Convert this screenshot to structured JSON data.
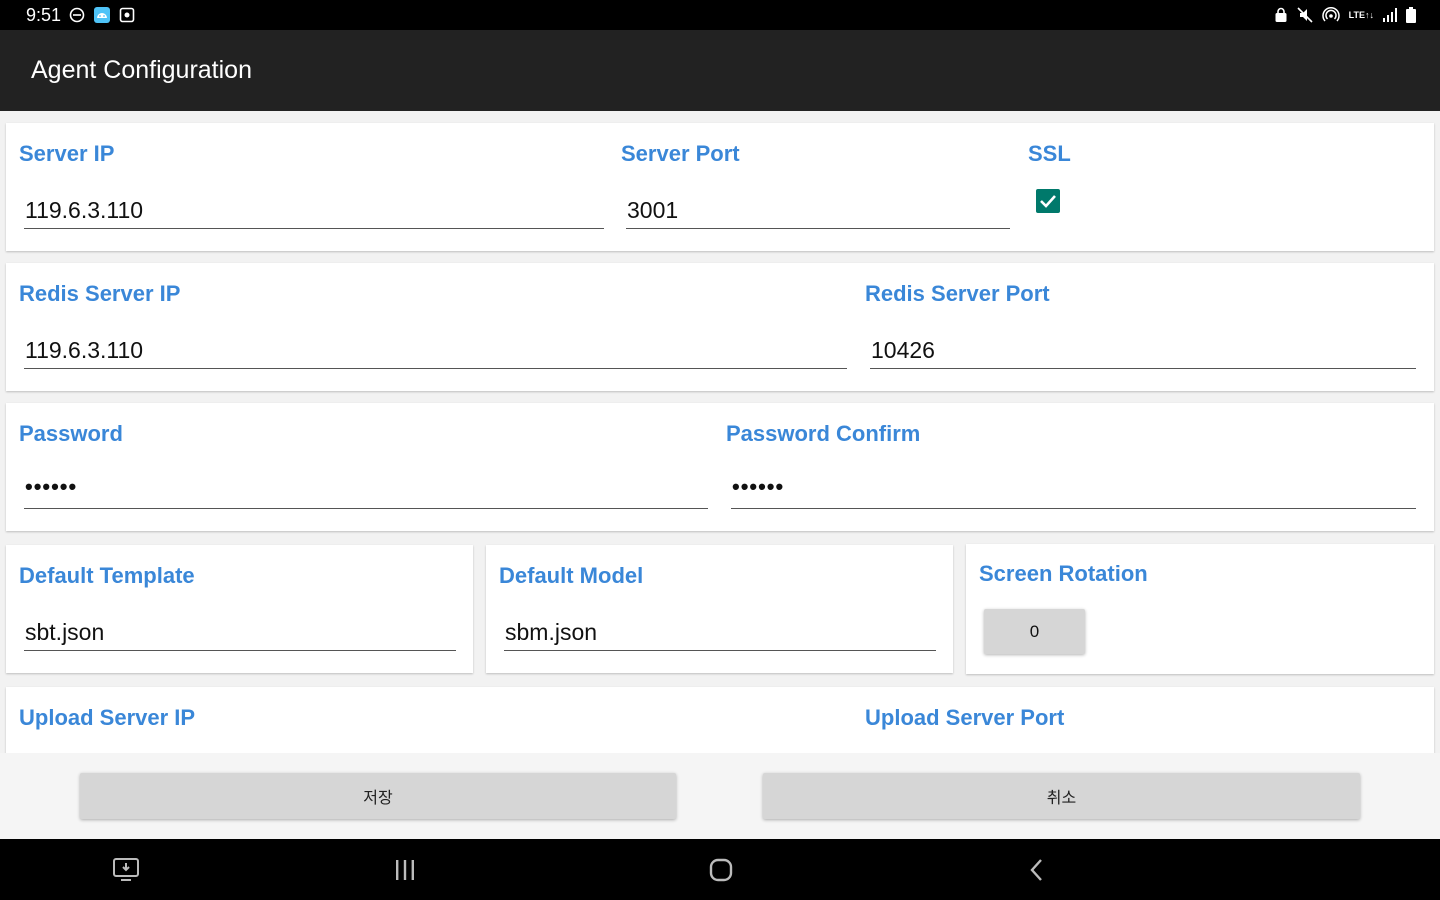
{
  "status_bar": {
    "time": "9:51",
    "left_icons": [
      "dnd-icon",
      "android-icon",
      "screenshot-icon"
    ],
    "right_icons": [
      "lock-icon",
      "mute-icon",
      "hotspot-icon",
      "lte-icon",
      "signal-icon",
      "battery-icon"
    ],
    "lte_top": "LTE",
    "lte_bottom": "↑↓"
  },
  "app_bar": {
    "title": "Agent Configuration"
  },
  "server": {
    "ip_label": "Server IP",
    "ip_value": "119.6.3.110",
    "port_label": "Server Port",
    "port_value": "3001",
    "ssl_label": "SSL",
    "ssl_checked": true
  },
  "redis": {
    "ip_label": "Redis Server IP",
    "ip_value": "119.6.3.110",
    "port_label": "Redis Server Port",
    "port_value": "10426"
  },
  "password": {
    "label": "Password",
    "value": "••••••",
    "confirm_label": "Password Confirm",
    "confirm_value": "••••••"
  },
  "defaults": {
    "template_label": "Default Template",
    "template_value": "sbt.json",
    "model_label": "Default Model",
    "model_value": "sbm.json",
    "rotation_label": "Screen Rotation",
    "rotation_value": "0"
  },
  "upload": {
    "ip_label": "Upload Server IP",
    "port_label": "Upload Server Port"
  },
  "actions": {
    "save_label": "저장",
    "cancel_label": "취소"
  },
  "nav_bar": {
    "icons": [
      "recent-apps-icon",
      "home-icon",
      "back-icon",
      "screen-cast-icon"
    ]
  },
  "colors": {
    "label": "#3a87d8",
    "checkbox": "#00796b",
    "app_bar": "#222222"
  }
}
